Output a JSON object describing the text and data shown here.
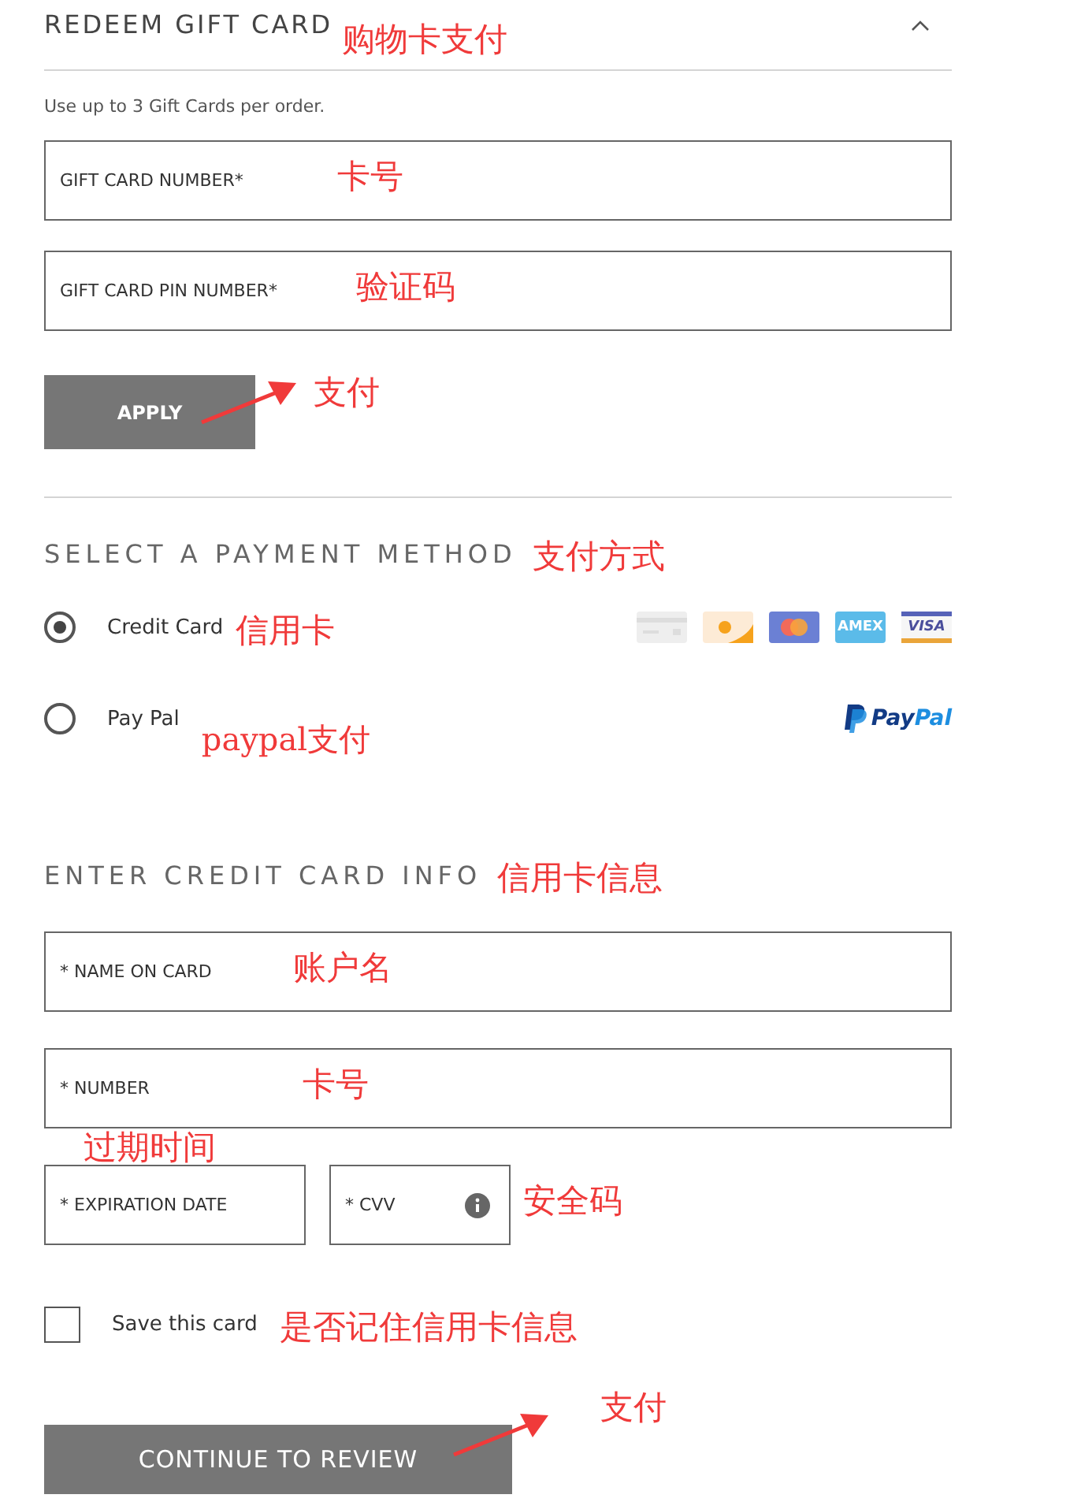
{
  "gift_card": {
    "title": "REDEEM GIFT CARD",
    "title_note": "购物卡支付",
    "expanded": true,
    "hint": "Use up to 3 Gift Cards per order.",
    "fields": [
      {
        "placeholder": "GIFT CARD NUMBER*",
        "note": "卡号"
      },
      {
        "placeholder": "GIFT CARD PIN NUMBER*",
        "note": "验证码"
      }
    ],
    "button": "APPLY",
    "button_note": "支付"
  },
  "payment_method": {
    "title": "SELECT A PAYMENT METHOD",
    "title_note": "支付方式",
    "options": [
      {
        "label": "Credit Card",
        "note": "信用卡",
        "selected": true,
        "kind": "cards"
      },
      {
        "label": "Pay Pal",
        "note": "paypal支付",
        "selected": false,
        "kind": "paypal"
      }
    ],
    "card_logos": [
      {
        "kind": "generic"
      },
      {
        "kind": "discover"
      },
      {
        "kind": "mastercard"
      },
      {
        "kind": "amex",
        "label": "AMEX"
      },
      {
        "kind": "visa",
        "label": "VISA"
      }
    ],
    "paypal_logo": "PayPal"
  },
  "card_info": {
    "title": "ENTER CREDIT CARD INFO",
    "title_note": "信用卡信息",
    "fields": [
      {
        "placeholder": "* NAME ON CARD",
        "note": "账户名"
      },
      {
        "placeholder": "* NUMBER",
        "note": "卡号"
      }
    ],
    "half_fields": [
      {
        "placeholder": "* EXPIRATION DATE",
        "note": "过期时间",
        "kind": "date"
      },
      {
        "placeholder": "* CVV",
        "note": "安全码",
        "kind": "cvv"
      }
    ],
    "save": {
      "label": "Save this card",
      "note": "是否记住信用卡信息",
      "checked": false
    },
    "button": "CONTINUE TO REVIEW",
    "button_note": "支付"
  }
}
